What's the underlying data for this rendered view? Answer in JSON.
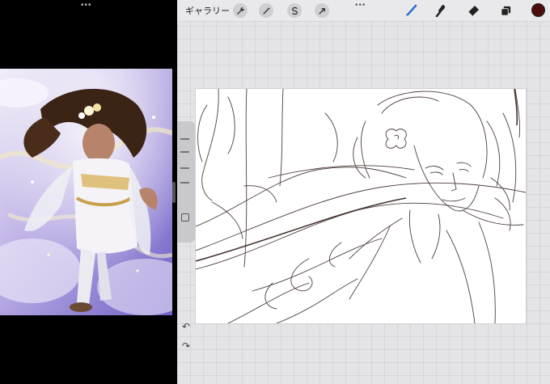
{
  "left_pane": {
    "multitask_dots": "•••",
    "reference_image": "character-illustration"
  },
  "right_pane": {
    "multitask_dots": "•••",
    "toolbar": {
      "gallery_label": "ギャラリー",
      "actions_icon": "wrench-icon",
      "adjustments_icon": "magic-wand-icon",
      "selection_icon": "selection-s-icon",
      "transform_icon": "arrow-cursor-icon",
      "brush_icon": "brush-icon",
      "smudge_icon": "smudge-icon",
      "eraser_icon": "eraser-icon",
      "layers_icon": "layers-icon",
      "current_color": "#4a0f0d"
    },
    "sidebar": {
      "undo_icon": "undo-icon",
      "redo_icon": "redo-icon"
    }
  },
  "colors": {
    "canvas_bg": "#ffffff",
    "ui_bg": "#e4e4e6",
    "brush_active": "#2f6bd8",
    "sketch_line": "#3a2a28"
  }
}
